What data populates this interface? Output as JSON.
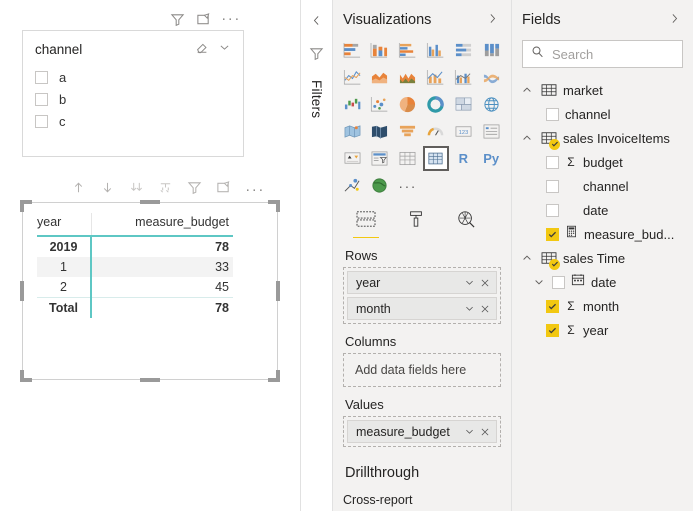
{
  "canvas": {
    "slicer": {
      "title": "channel",
      "header_icons": [
        "filter-icon",
        "focus-mode-icon",
        "more-options-icon"
      ],
      "control_icons": [
        "clear-selection-icon",
        "chevron-down-icon"
      ],
      "items": [
        {
          "label": "a",
          "checked": false
        },
        {
          "label": "b",
          "checked": false
        },
        {
          "label": "c",
          "checked": false
        }
      ]
    },
    "matrix": {
      "header_icons": [
        "drill-up-icon",
        "drill-down-icon",
        "expand-all-icon",
        "drill-mode-icon",
        "filter-icon",
        "focus-mode-icon",
        "more-options-icon"
      ],
      "columns": [
        "year",
        "measure_budget"
      ],
      "rows": [
        {
          "label": "2019",
          "value": "78",
          "bold": true,
          "alt": false
        },
        {
          "label": "1",
          "value": "33",
          "bold": false,
          "alt": true
        },
        {
          "label": "2",
          "value": "45",
          "bold": false,
          "alt": false
        },
        {
          "label": "Total",
          "value": "78",
          "bold": true,
          "alt": false
        }
      ],
      "accent_color": "#5ec7c4"
    }
  },
  "filters_rail": {
    "label": "Filters",
    "icons": [
      "chevron-left-icon",
      "filter-icon"
    ]
  },
  "visualizations": {
    "title": "Visualizations",
    "expand_icon": "chevron-right-icon",
    "gallery": [
      {
        "name": "stacked-bar-chart",
        "selected": false
      },
      {
        "name": "stacked-column-chart",
        "selected": false
      },
      {
        "name": "clustered-bar-chart",
        "selected": false
      },
      {
        "name": "clustered-column-chart",
        "selected": false
      },
      {
        "name": "100-stacked-bar-chart",
        "selected": false
      },
      {
        "name": "100-stacked-column-chart",
        "selected": false
      },
      {
        "name": "line-chart",
        "selected": false
      },
      {
        "name": "area-chart",
        "selected": false
      },
      {
        "name": "stacked-area-chart",
        "selected": false
      },
      {
        "name": "line-stacked-column-chart",
        "selected": false
      },
      {
        "name": "line-clustered-column-chart",
        "selected": false
      },
      {
        "name": "ribbon-chart",
        "selected": false
      },
      {
        "name": "waterfall-chart",
        "selected": false
      },
      {
        "name": "scatter-chart",
        "selected": false
      },
      {
        "name": "pie-chart",
        "selected": false
      },
      {
        "name": "donut-chart",
        "selected": false
      },
      {
        "name": "treemap-chart",
        "selected": false
      },
      {
        "name": "map-visual",
        "selected": false
      },
      {
        "name": "filled-map-visual",
        "selected": false
      },
      {
        "name": "shape-map-visual",
        "selected": false
      },
      {
        "name": "funnel-chart",
        "selected": false
      },
      {
        "name": "gauge-chart",
        "selected": false
      },
      {
        "name": "card-visual",
        "selected": false
      },
      {
        "name": "multi-row-card-visual",
        "selected": false
      },
      {
        "name": "kpi-visual",
        "selected": false
      },
      {
        "name": "slicer-visual",
        "selected": false
      },
      {
        "name": "table-visual",
        "selected": false
      },
      {
        "name": "matrix-visual",
        "selected": true
      },
      {
        "name": "r-script-visual",
        "selected": false,
        "text": "R"
      },
      {
        "name": "python-script-visual",
        "selected": false,
        "text": "Py"
      },
      {
        "name": "key-influencers-visual",
        "selected": false
      },
      {
        "name": "arcgis-map-visual",
        "selected": false
      },
      {
        "name": "more-visuals-icon",
        "selected": false,
        "text": "···"
      }
    ],
    "tabs": [
      {
        "name": "fields-tab",
        "icon": "fields-icon",
        "active": true
      },
      {
        "name": "format-tab",
        "icon": "paint-roller-icon",
        "active": false
      },
      {
        "name": "analytics-tab",
        "icon": "analytics-magnifier-icon",
        "active": false
      }
    ],
    "wells": [
      {
        "label": "Rows",
        "fields": [
          {
            "name": "year"
          },
          {
            "name": "month"
          }
        ],
        "placeholder": null
      },
      {
        "label": "Columns",
        "fields": [],
        "placeholder": "Add data fields here"
      },
      {
        "label": "Values",
        "fields": [
          {
            "name": "measure_budget"
          }
        ],
        "placeholder": null
      }
    ],
    "drillthrough_title": "Drillthrough",
    "cross_report_label": "Cross-report"
  },
  "fields": {
    "title": "Fields",
    "expand_icon": "chevron-right-icon",
    "search": {
      "placeholder": "Search",
      "value": "",
      "icon": "search-icon"
    },
    "tables": [
      {
        "name": "market",
        "expanded": true,
        "used": false,
        "items": [
          {
            "name": "channel",
            "checked": false,
            "measure": false,
            "icon": null
          }
        ]
      },
      {
        "name": "sales InvoiceItems",
        "expanded": true,
        "used": true,
        "items": [
          {
            "name": "budget",
            "checked": false,
            "measure": true,
            "icon": null
          },
          {
            "name": "channel",
            "checked": false,
            "measure": false,
            "icon": null
          },
          {
            "name": "date",
            "checked": false,
            "measure": false,
            "icon": null
          },
          {
            "name": "measure_bud...",
            "checked": true,
            "measure": false,
            "icon": "calculator-icon"
          }
        ]
      },
      {
        "name": "sales Time",
        "expanded": true,
        "used": true,
        "items": [
          {
            "name": "date",
            "checked": false,
            "measure": false,
            "icon": "calendar-icon",
            "hierarchy": true
          },
          {
            "name": "month",
            "checked": true,
            "measure": true,
            "icon": null
          },
          {
            "name": "year",
            "checked": true,
            "measure": true,
            "icon": null
          }
        ]
      }
    ]
  },
  "colors": {
    "pane_bg": "#f3f2f1",
    "accent_yellow": "#f2c811",
    "matrix_accent": "#5ec7c4"
  }
}
